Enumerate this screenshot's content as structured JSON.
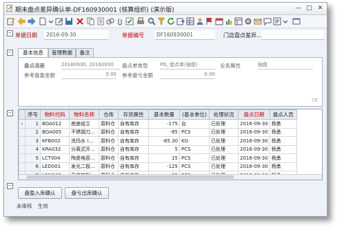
{
  "window": {
    "title": "期末盘点差异确认单-DF160930001 (核算组织) (演示版)",
    "minimize": "—",
    "maximize": "□",
    "close": "✕"
  },
  "toolbar": {
    "icons": [
      "edit-icon",
      "back-icon",
      "forward-icon",
      "new-icon",
      "modify-icon",
      "save-icon",
      "delete-icon",
      "copy-icon",
      "link-icon",
      "print-icon",
      "search-icon",
      "filter-icon",
      "refresh-icon",
      "export-icon",
      "mail-icon",
      "message-icon",
      "settings-icon",
      "help-icon"
    ]
  },
  "header": {
    "date_label": "单据日期",
    "date_value": "2016-09-30",
    "number_label": "单据编号",
    "number_value": "DF160930001",
    "store_label": "门店盘点差异..."
  },
  "tabs": [
    "基本信息",
    "管理数据",
    "备注"
  ],
  "basic": {
    "stocktake_label": "盘点清册",
    "stocktake_value": "20160930, 20160930",
    "type_label": "盘点单类型",
    "type_value": "PD, 盘点单(抽盘)",
    "attr_label": "业务属性",
    "attr_value": "抽盘",
    "ref_amount_label": "参考盘盈金额",
    "ref_amount_value": "0.00",
    "ref_loss_label": "参考盘亏金额",
    "ref_loss_value": "0.00",
    "logo": "TB"
  },
  "grid": {
    "columns": [
      "序号",
      "物料代码",
      "物料名称",
      "仓库",
      "存货属性",
      "基本数量",
      "(基本单位)",
      "处理状况",
      "盘点日期",
      "盘点人员"
    ],
    "rows": [
      {
        "no": "1",
        "code": "BOA012",
        "name": "底座组立",
        "wh": "原料仓",
        "attr": "自有库存",
        "qty": "-175",
        "unit": "台",
        "status": "已处理",
        "date": "2016-09-30",
        "person": "杨勇"
      },
      {
        "no": "2",
        "code": "BOA005",
        "name": "不锈钢刀...",
        "wh": "原料仓",
        "attr": "自有库存",
        "qty": "-85",
        "unit": "PCS",
        "status": "已处理",
        "date": "2016-09-30",
        "person": "杨勇"
      },
      {
        "no": "3",
        "code": "KFB002",
        "name": "洗玛水 (...",
        "wh": "原料仓",
        "attr": "自有库存",
        "qty": "-65.30",
        "unit": "KG",
        "status": "已处理",
        "date": "2016-09-30",
        "person": "杨勇"
      },
      {
        "no": "4",
        "code": "KRA032",
        "name": "分离式开...",
        "wh": "原料仓",
        "attr": "自有库存",
        "qty": "5",
        "unit": "PCS",
        "status": "已处理",
        "date": "2016-09-30",
        "person": "杨勇"
      },
      {
        "no": "5",
        "code": "LCT004",
        "name": "陶瓷电容...",
        "wh": "原料仓",
        "attr": "自有库存",
        "qty": "15",
        "unit": "PCS",
        "status": "已处理",
        "date": "2016-09-30",
        "person": "杨勇"
      },
      {
        "no": "6",
        "code": "LED001",
        "name": "发光二极...",
        "wh": "原料仓",
        "attr": "自有库存",
        "qty": "-125",
        "unit": "PCS",
        "status": "已处理",
        "date": "2016-09-30",
        "person": "杨勇"
      },
      {
        "no": "7",
        "code": "LEM002",
        "name": "开关控制...",
        "wh": "原料仓",
        "attr": "自有库存",
        "qty": "-55",
        "unit": "PCS",
        "status": "已处理",
        "date": "2016-09-30",
        "person": "杨勇"
      }
    ]
  },
  "buttons": {
    "profit_confirm": "盘盈入库确认",
    "loss_confirm": "盘亏出库确认"
  },
  "status": {
    "audit": "未审核",
    "effect": "生效"
  }
}
